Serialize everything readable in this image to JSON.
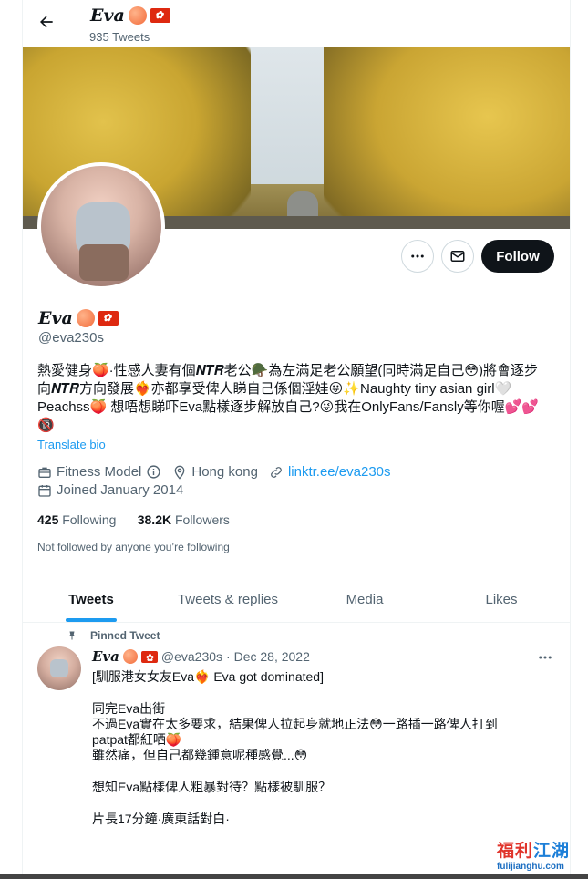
{
  "header": {
    "name": "Eva",
    "tweet_count": "935 Tweets"
  },
  "actions": {
    "follow_label": "Follow"
  },
  "profile": {
    "name": "Eva",
    "handle": "@eva230s",
    "bio_lines": [
      "熱愛健身🍑·性感人妻有個𝑵𝑻𝑹老公🪖為左滿足老公願望(同時滿足自己😳)將會逐步",
      "向𝑵𝑻𝑹方向發展❤️‍🔥亦都享受俾人睇自己係個淫娃😛✨Naughty tiny asian girl🤍",
      "Peachss🍑 想唔想睇吓Eva點樣逐步解放自己?😜我在OnlyFans/Fansly等你喔💕💕",
      "🔞"
    ],
    "translate_label": "Translate bio",
    "category": "Fitness Model",
    "location": "Hong kong",
    "link": "linktr.ee/eva230s",
    "joined": "Joined January 2014",
    "following_count": "425",
    "following_label": "Following",
    "followers_count": "38.2K",
    "followers_label": "Followers",
    "not_followed": "Not followed by anyone you’re following"
  },
  "tabs": [
    {
      "label": "Tweets",
      "active": true
    },
    {
      "label": "Tweets & replies",
      "active": false
    },
    {
      "label": "Media",
      "active": false
    },
    {
      "label": "Likes",
      "active": false
    }
  ],
  "pinned_tweet": {
    "pinned_label": "Pinned Tweet",
    "name": "Eva",
    "handle": "@eva230s",
    "date": "· Dec 28, 2022",
    "lines": [
      "[馴服港女女友Eva❤️‍🔥 Eva got dominated]",
      "",
      "同完Eva出街",
      "不過Eva實在太多要求，結果俾人拉起身就地正法😳一路插一路俾人打到",
      "patpat都紅哂🍑",
      "雖然痛，但自己都幾鍾意呢種感覺...😳",
      "",
      "想知Eva點樣俾人粗暴對待？點樣被馴服？",
      "",
      "片長17分鐘·廣東話對白·"
    ]
  },
  "watermark": {
    "main_a": "福利",
    "main_b": "江湖",
    "sub": "fulijianghu.com"
  },
  "colors": {
    "accent": "#1d9bf0",
    "text": "#0f1419",
    "muted": "#536471",
    "follow_bg": "#0f1419"
  }
}
